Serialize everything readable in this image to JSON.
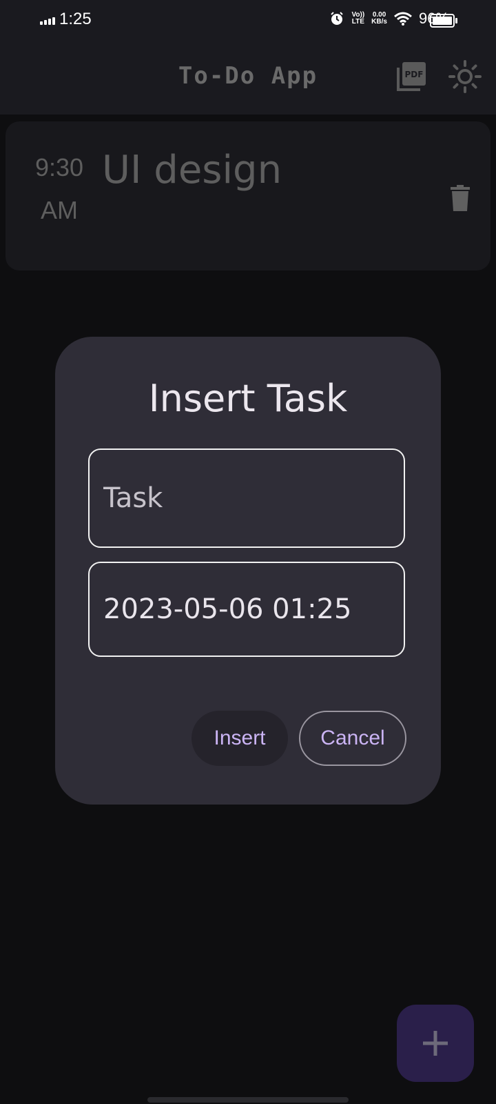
{
  "status_bar": {
    "time": "1:25",
    "network_top": "Vo))",
    "network_bottom": "LTE",
    "speed_value": "0.00",
    "speed_unit": "KB/s",
    "battery_percent": "96%"
  },
  "app_bar": {
    "title": "To-Do App",
    "icons": [
      "pdf-icon",
      "brightness-icon"
    ]
  },
  "task": {
    "time_line1": "9:30",
    "time_line2": "AM",
    "title": "UI design"
  },
  "dialog": {
    "title": "Insert Task",
    "task_placeholder": "Task",
    "task_value": "",
    "datetime_value": "2023-05-06 01:25",
    "insert_label": "Insert",
    "cancel_label": "Cancel"
  },
  "colors": {
    "background": "#0e0e10",
    "dialog": "#2f2d37",
    "accent": "#cbb4f4",
    "fab": "#2a1f4a"
  }
}
